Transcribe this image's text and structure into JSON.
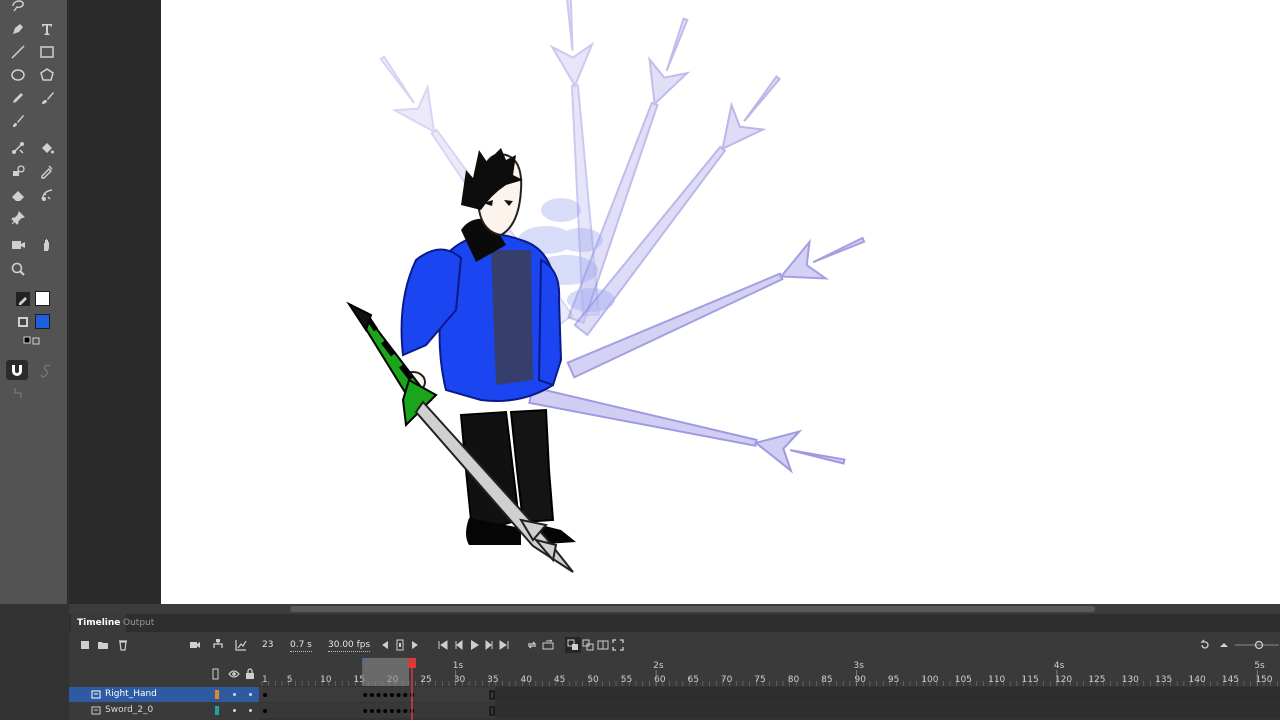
{
  "timeline_panel": {
    "tabs": [
      "Timeline",
      "Output"
    ],
    "current_frame": "23",
    "time": "0.7 s",
    "fps": "30.00 fps"
  },
  "ruler": {
    "frame_numbers": [
      "1",
      "5",
      "10",
      "15",
      "20",
      "25",
      "30",
      "35",
      "40",
      "45",
      "50",
      "55",
      "60",
      "65",
      "70",
      "75",
      "80",
      "85",
      "90",
      "95",
      "100",
      "105",
      "110",
      "115",
      "120",
      "125",
      "130",
      "135",
      "140",
      "145",
      "150"
    ],
    "second_marks": [
      "1s",
      "2s",
      "3s",
      "4s",
      "5s"
    ]
  },
  "layers": [
    {
      "name": "Right_Hand",
      "color": "#e08a2c",
      "selected": true
    },
    {
      "name": "Sword_2_0",
      "color": "#1fa3a3",
      "selected": false
    }
  ],
  "tools": [
    "lasso-icon",
    "text-icon",
    "pen-icon",
    "rectangle-icon",
    "line-icon",
    "polystar-icon",
    "oval-icon",
    "brush-icon",
    "pencil-icon",
    "paint-brush-icon",
    "bone-icon",
    "paint-bucket-icon",
    "width-icon",
    "eyedropper-icon",
    "eraser-icon",
    "asset-warp-icon",
    "pin-icon",
    "camera-icon",
    "hand-icon",
    "zoom-icon"
  ],
  "colors": {
    "stroke": "#000000",
    "fill": "#ffffff",
    "fill2": "#1e5fe0",
    "layer_highlight": "#2d5aa0",
    "playhead": "#d93a3a"
  }
}
